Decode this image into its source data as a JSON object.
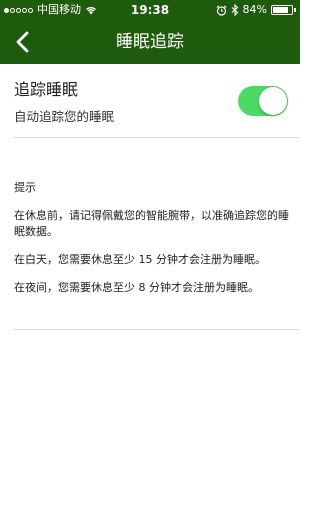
{
  "status_bar": {
    "carrier": "中国移动",
    "time": "19:38",
    "battery_percent": "84%",
    "battery_level": 0.84,
    "icons": [
      "signal-dots-icon",
      "wifi-icon",
      "alarm-icon",
      "bluetooth-icon",
      "battery-icon"
    ]
  },
  "nav": {
    "title": "睡眠追踪",
    "back_icon": "chevron-left-icon"
  },
  "track_sleep": {
    "title": "追踪睡眠",
    "subtitle": "自动追踪您的睡眠",
    "enabled": true
  },
  "tips": {
    "title": "提示",
    "items": [
      "在休息前，请记得佩戴您的智能腕带，以准确追踪您的睡眠数据。",
      "在白天，您需要休息至少 15 分钟才会注册为睡眠。",
      "在夜间，您需要休息至少 8 分钟才会注册为睡眠。"
    ]
  },
  "colors": {
    "header_bg": "#1e5b0d",
    "toggle_on": "#4cd964"
  }
}
